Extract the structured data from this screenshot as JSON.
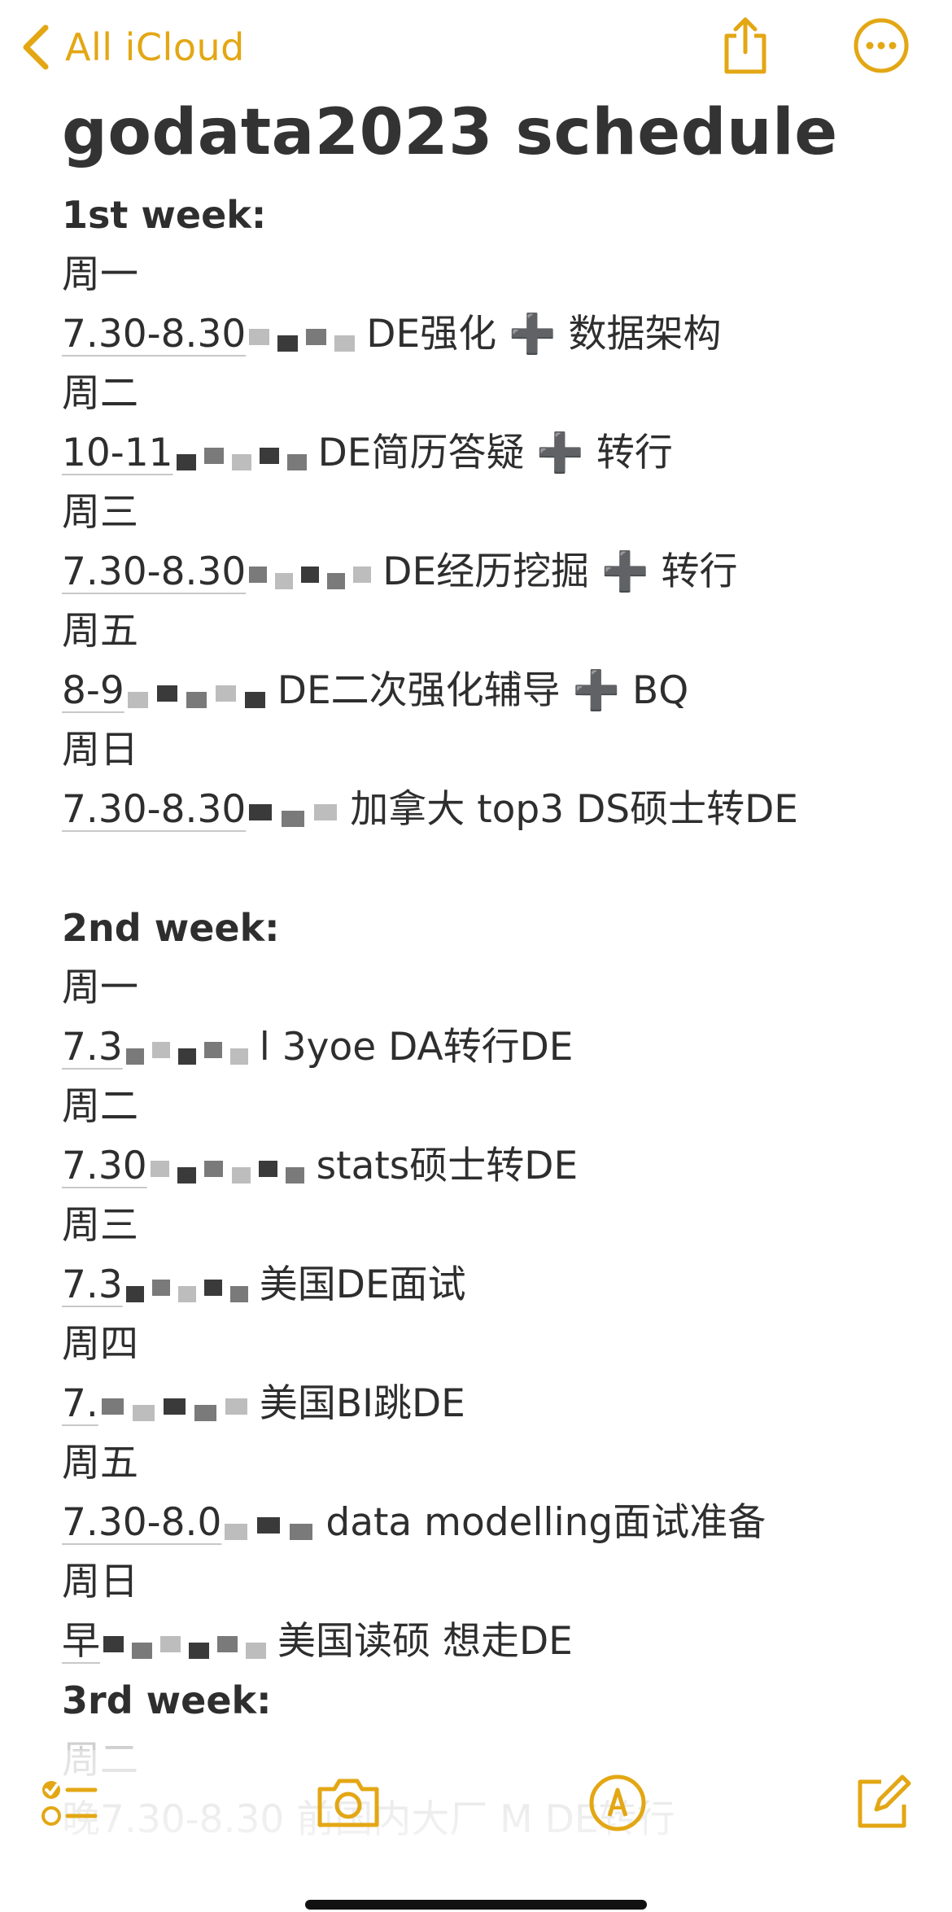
{
  "nav": {
    "back_label": "All iCloud",
    "accent": "#e3a714"
  },
  "note": {
    "title": "godata2023 schedule",
    "lines": [
      {
        "type": "heading",
        "text": "1st week:"
      },
      {
        "type": "day",
        "text": "周一"
      },
      {
        "type": "entry",
        "time": "7.30-8.30",
        "text": "DE强化 ➕ 数据架构"
      },
      {
        "type": "day",
        "text": "周二"
      },
      {
        "type": "entry",
        "time": "10-11",
        "text": "DE简历答疑 ➕ 转行"
      },
      {
        "type": "day",
        "text": "周三"
      },
      {
        "type": "entry",
        "time": "7.30-8.30",
        "text": "DE经历挖掘 ➕ 转行"
      },
      {
        "type": "day",
        "text": "周五"
      },
      {
        "type": "entry",
        "time": "8-9",
        "text": "DE二次强化辅导 ➕ BQ"
      },
      {
        "type": "day",
        "text": "周日"
      },
      {
        "type": "entry",
        "time": "7.30-8.30",
        "text": "加拿大 top3 DS硕士转DE"
      },
      {
        "type": "blank",
        "text": ""
      },
      {
        "type": "heading",
        "text": "2nd week:"
      },
      {
        "type": "day",
        "text": "周一"
      },
      {
        "type": "entry",
        "time": "7.3",
        "text": "l 3yoe DA转行DE"
      },
      {
        "type": "day",
        "text": "周二"
      },
      {
        "type": "entry",
        "time": "7.30",
        "text": "stats硕士转DE"
      },
      {
        "type": "day",
        "text": "周三"
      },
      {
        "type": "entry",
        "time": "7.3",
        "text": "美国DE面试"
      },
      {
        "type": "day",
        "text": "周四"
      },
      {
        "type": "entry",
        "time": "7.",
        "text": "美国BI跳DE"
      },
      {
        "type": "day",
        "text": "周五"
      },
      {
        "type": "entry",
        "time": "7.30-8.0",
        "text": "data modelling面试准备"
      },
      {
        "type": "day",
        "text": "周日"
      },
      {
        "type": "entry",
        "time": "早",
        "text": "美国读硕 想走DE"
      },
      {
        "type": "heading",
        "text": "3rd week:"
      },
      {
        "type": "faded",
        "text": "周二"
      },
      {
        "type": "faded",
        "text": "晚7.30-8.30 前国内大厂 M DE转行"
      }
    ]
  },
  "toolbar": {
    "items": [
      "checklist-icon",
      "camera-icon",
      "markup-icon",
      "compose-icon"
    ]
  }
}
